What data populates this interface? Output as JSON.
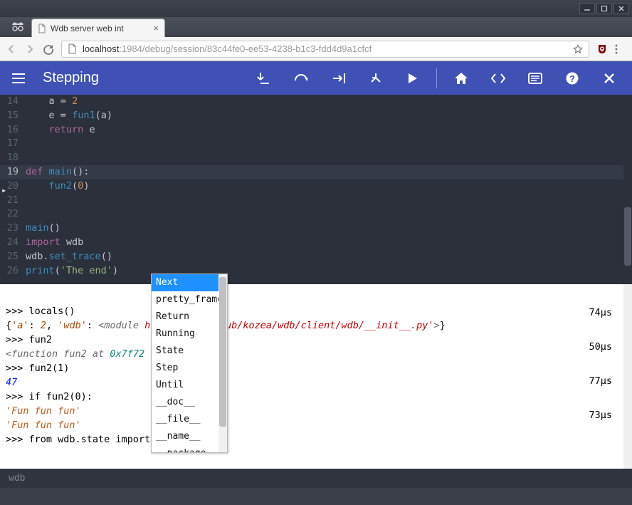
{
  "os": {
    "minimize_icon": "minimize-icon",
    "maximize_icon": "maximize-icon",
    "close_icon": "close-icon"
  },
  "browser": {
    "tab": {
      "title": "Wdb server web int"
    },
    "url_host": "localhost",
    "url_port": ":1984",
    "url_path": "/debug/session/83c44fe0-ee53-4238-b1c3-fdd4d9a1cfcf"
  },
  "header": {
    "title": "Stepping",
    "buttons": {
      "step_in": "step-in",
      "step_over": "step-over",
      "step_out": "step-out",
      "step_up": "step-up",
      "run": "run",
      "home": "home",
      "source": "source",
      "output": "output",
      "help": "help",
      "close": "close"
    }
  },
  "code_lines": [
    {
      "n": "14",
      "html": "    <span class='tok-id'>a</span> <span class='tok-op'>=</span> <span class='tok-num'>2</span>",
      "current": false
    },
    {
      "n": "15",
      "html": "    <span class='tok-id'>e</span> <span class='tok-op'>=</span> <span class='tok-fn'>fun1</span>(<span class='tok-id'>a</span>)",
      "current": false
    },
    {
      "n": "16",
      "html": "    <span class='tok-kw'>return</span> <span class='tok-id'>e</span>",
      "current": false
    },
    {
      "n": "17",
      "html": "",
      "current": false
    },
    {
      "n": "18",
      "html": "",
      "current": false
    },
    {
      "n": "19",
      "html": "<span class='tok-kw'>def</span> <span class='tok-def'>main</span>():",
      "current": true
    },
    {
      "n": "20",
      "html": "    <span class='tok-fn'>fun2</span>(<span class='tok-num'>0</span>)",
      "current": false
    },
    {
      "n": "21",
      "html": "",
      "current": false
    },
    {
      "n": "22",
      "html": "",
      "current": false
    },
    {
      "n": "23",
      "html": "<span class='tok-fn'>main</span>()",
      "current": false
    },
    {
      "n": "24",
      "html": "<span class='tok-kw'>import</span> <span class='tok-id'>wdb</span>",
      "current": false
    },
    {
      "n": "25",
      "html": "<span class='tok-id'>wdb</span>.<span class='tok-fn'>set_trace</span>()",
      "current": false
    },
    {
      "n": "26",
      "html": "<span class='tok-fn'>print</span>(<span class='tok-str'>'The end'</span>)",
      "current": false
    }
  ],
  "console": {
    "entries": [
      {
        "prompt": ">>> locals()",
        "timing": "74µs",
        "out_html": "{<span class='con-brown con-ital'>'a'</span>: <span class='con-brown con-ital'>2</span>, <span class='con-brown con-ital'>'wdb'</span>: <span class='con-grey con-ital'>&lt;module</span> <span class='con-red con-ital'>                  home/zero/github/kozea/wdb/client/wdb/__init__.py'</span><span class='con-grey con-ital'>&gt;</span>}"
      },
      {
        "prompt": ">>> fun2",
        "timing": "50µs",
        "out_html": "<span class='con-grey con-ital'>&lt;function fun2 at</span> <span class='con-teal con-ital'>0x7f72</span>"
      },
      {
        "prompt": ">>> fun2(1)",
        "timing": "77µs",
        "out_html": "<span class='con-blue con-ital'>47</span>"
      },
      {
        "prompt": ">>> if fun2(0):",
        "timing": "73µs",
        "continuation_html": "      <span class='con-str'>'Fun fun fun'</span>",
        "out_html": "<span class='con-str'>'Fun fun fun'</span>"
      },
      {
        "prompt": ">>> from wdb.state import",
        "timing": "",
        "out_html": ""
      }
    ]
  },
  "autocomplete": {
    "selected_index": 0,
    "items": [
      "Next",
      "pretty_frame",
      "Return",
      "Running",
      "State",
      "Step",
      "Until",
      "__doc__",
      "__file__",
      "__name__",
      "__package"
    ]
  },
  "footer": {
    "placeholder": "wdb"
  }
}
